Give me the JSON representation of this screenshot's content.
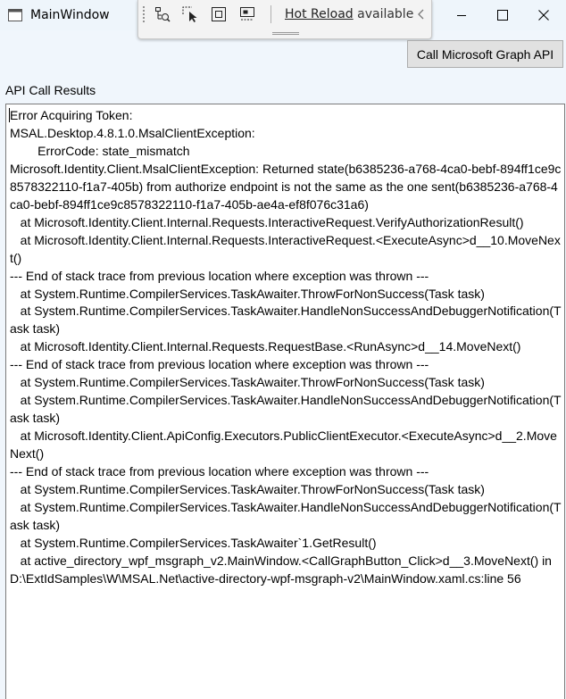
{
  "window": {
    "title": "MainWindow",
    "icon": "window-icon",
    "controls": [
      "minimize-icon",
      "maximize-icon",
      "close-icon"
    ]
  },
  "hot_reload_toolbar": {
    "icons": [
      "live-visual-tree-icon",
      "select-element-icon",
      "display-layout-adorners-icon",
      "track-focused-element-icon"
    ],
    "link_label": "Hot Reload",
    "status_text": " available",
    "collapse_icon": "chevron-left-icon"
  },
  "call_button": {
    "label": "Call Microsoft Graph API"
  },
  "results": {
    "label": "API Call Results",
    "text": "Error Acquiring Token:\nMSAL.Desktop.4.8.1.0.MsalClientException: \n\tErrorCode: state_mismatch\nMicrosoft.Identity.Client.MsalClientException: Returned state(b6385236-a768-4ca0-bebf-894ff1ce9c8578322110-f1a7-405b) from authorize endpoint is not the same as the one sent(b6385236-a768-4ca0-bebf-894ff1ce9c8578322110-f1a7-405b-ae4a-ef8f076c31a6)\n   at Microsoft.Identity.Client.Internal.Requests.InteractiveRequest.VerifyAuthorizationResult()\n   at Microsoft.Identity.Client.Internal.Requests.InteractiveRequest.<ExecuteAsync>d__10.MoveNext()\n--- End of stack trace from previous location where exception was thrown ---\n   at System.Runtime.CompilerServices.TaskAwaiter.ThrowForNonSuccess(Task task)\n   at System.Runtime.CompilerServices.TaskAwaiter.HandleNonSuccessAndDebuggerNotification(Task task)\n   at Microsoft.Identity.Client.Internal.Requests.RequestBase.<RunAsync>d__14.MoveNext()\n--- End of stack trace from previous location where exception was thrown ---\n   at System.Runtime.CompilerServices.TaskAwaiter.ThrowForNonSuccess(Task task)\n   at System.Runtime.CompilerServices.TaskAwaiter.HandleNonSuccessAndDebuggerNotification(Task task)\n   at Microsoft.Identity.Client.ApiConfig.Executors.PublicClientExecutor.<ExecuteAsync>d__2.MoveNext()\n--- End of stack trace from previous location where exception was thrown ---\n   at System.Runtime.CompilerServices.TaskAwaiter.ThrowForNonSuccess(Task task)\n   at System.Runtime.CompilerServices.TaskAwaiter.HandleNonSuccessAndDebuggerNotification(Task task)\n   at System.Runtime.CompilerServices.TaskAwaiter`1.GetResult()\n   at active_directory_wpf_msgraph_v2.MainWindow.<CallGraphButton_Click>d__3.MoveNext() in D:\\ExtIdSamples\\W\\MSAL.Net\\active-directory-wpf-msgraph-v2\\MainWindow.xaml.cs:line 56"
  }
}
